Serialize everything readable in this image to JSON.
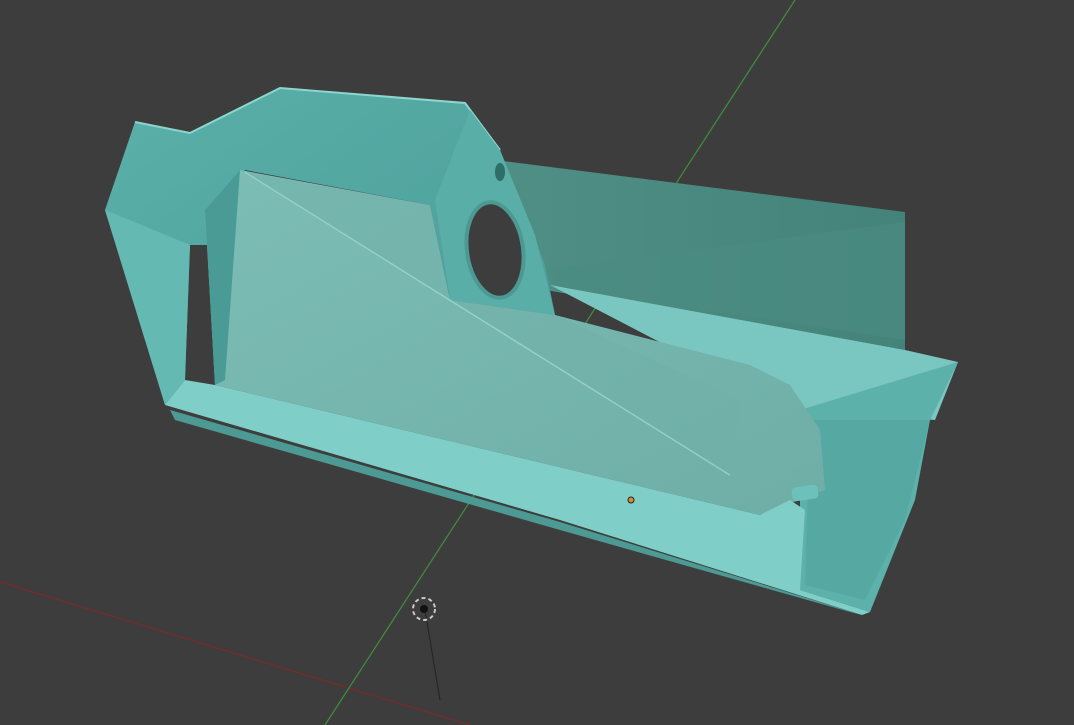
{
  "viewport": {
    "background": "#3d3d3d",
    "x_axis_color": "#8a2a2a",
    "y_axis_color": "#3f8f3f",
    "model_color": "#5fb3ad",
    "model_dark": "#3f8680",
    "model_light": "#8fd0c9",
    "origin_dot_color": "#d98a2a"
  },
  "gizmos": {
    "origin_icon": "origin-marker-icon",
    "cursor_icon": "3d-cursor-icon",
    "camera_icon": "camera-icon"
  }
}
